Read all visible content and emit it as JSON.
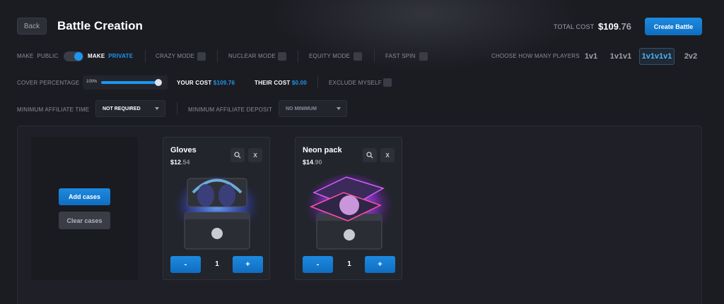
{
  "header": {
    "back_label": "Back",
    "title": "Battle Creation",
    "total_label": "TOTAL COST",
    "total_dollars": "$109",
    "total_cents": ".76",
    "create_label": "Create Battle"
  },
  "options": {
    "make_public_label": "MAKE",
    "public_label": "PUBLIC",
    "make_private_label": "MAKE",
    "private_label": "PRIVATE",
    "crazy_mode": "CRAZY MODE",
    "nuclear_mode": "NUCLEAR MODE",
    "equity_mode": "EQUITY MODE",
    "fast_spin": "FAST SPIN",
    "players_label": "CHOOSE HOW MANY PLAYERS",
    "player_options": [
      "1v1",
      "1v1v1",
      "1v1v1v1",
      "2v2"
    ],
    "selected_players": "1v1v1v1"
  },
  "cover": {
    "label": "COVER PERCENTAGE",
    "percent": "100%",
    "value": 1.0,
    "your_cost_label": "YOUR COST",
    "your_cost_value": "$109.76",
    "their_cost_label": "THEIR COST",
    "their_cost_value": "$0.00",
    "exclude_label": "EXCLUDE MYSELF"
  },
  "affiliate": {
    "time_label": "MINIMUM AFFILIATE TIME",
    "time_value": "NOT REQUIRED",
    "deposit_label": "MINIMUM AFFILIATE DEPOSIT",
    "deposit_value": "NO MINIMUM"
  },
  "actions": {
    "add_label": "Add cases",
    "clear_label": "Clear cases"
  },
  "cases": [
    {
      "name": "Gloves",
      "price_dollars": "$12",
      "price_cents": ".54",
      "quantity": "1",
      "minus": "-",
      "plus": "+",
      "remove": "X"
    },
    {
      "name": "Neon pack",
      "price_dollars": "$14",
      "price_cents": ".90",
      "quantity": "1",
      "minus": "-",
      "plus": "+",
      "remove": "X"
    }
  ],
  "colors": {
    "accent": "#1e96ee",
    "background": "#1b1c22",
    "card": "#23252d"
  }
}
